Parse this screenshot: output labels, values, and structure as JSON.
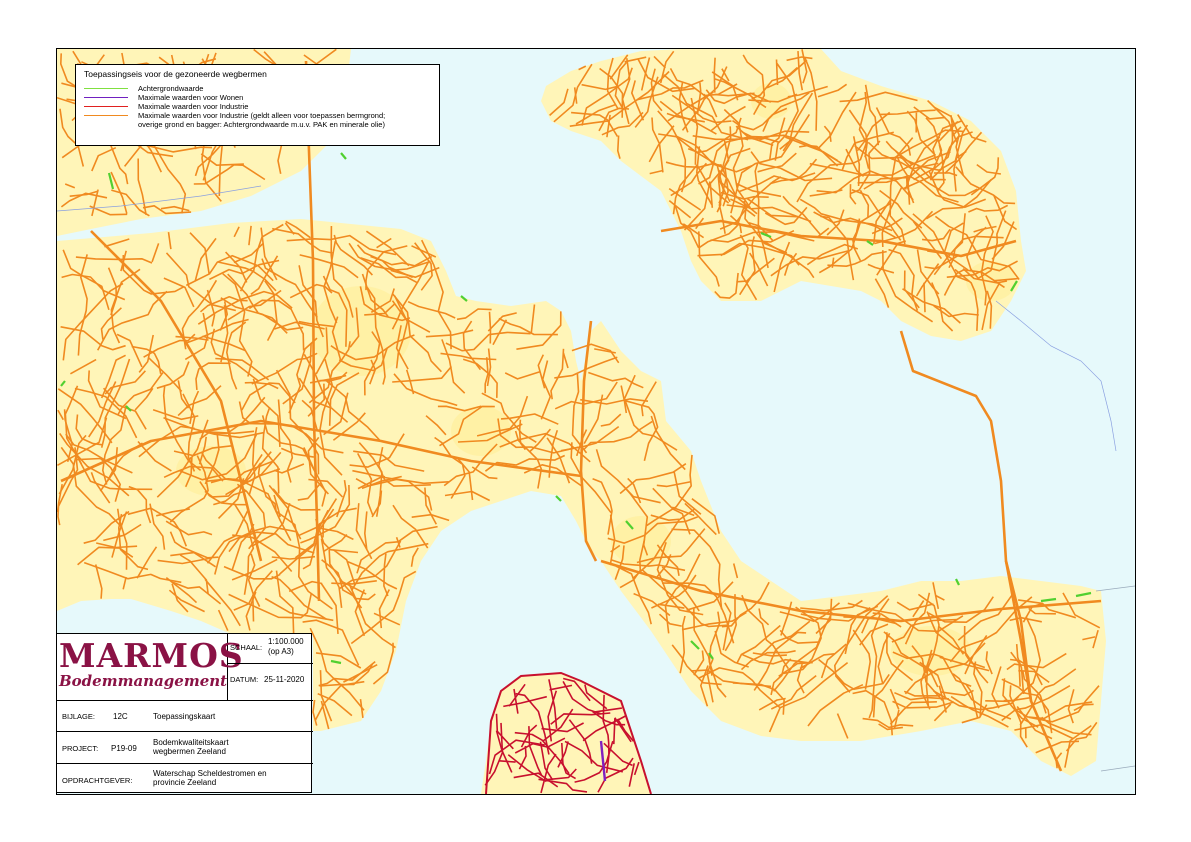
{
  "legend": {
    "title": "Toepassingseis voor de gezoneerde wegbermen",
    "items": [
      {
        "label": "Achtergrondwaarde",
        "color": "#80e040"
      },
      {
        "label": "Maximale waarden voor Wonen",
        "color": "#7020c0"
      },
      {
        "label": "Maximale waarden voor Industrie",
        "color": "#e02020"
      },
      {
        "label": "Maximale waarden voor Industrie (geldt alleen voor toepassen bermgrond;",
        "label2": "overige grond en bagger: Achtergrondwaarde m.u.v. PAK en minerale olie)",
        "color": "#f08a20"
      }
    ]
  },
  "colors": {
    "water": "#e6f9fb",
    "land": "#fff5b8",
    "road": "#f08a20",
    "road_red": "#c8102e",
    "road_green": "#50d030",
    "road_purple": "#8020c0",
    "logo": "#8a1245"
  },
  "titleblock": {
    "logo_main": "MARMOS",
    "logo_sub": "Bodemmanagement",
    "schaal_label": "SCHAAL:",
    "schaal_value": "1:100.000",
    "schaal_note": "(op A3)",
    "datum_label": "DATUM:",
    "datum_value": "25-11-2020",
    "bijlage_label": "BIJLAGE:",
    "bijlage_num": "12C",
    "bijlage_title": "Toepassingskaart",
    "project_label": "PROJECT:",
    "project_code": "P19-09",
    "project_title_1": "Bodemkwaliteitskaart",
    "project_title_2": "wegbermen Zeeland",
    "opdrachtgever_label": "OPDRACHTGEVER:",
    "opdrachtgever_1": "Waterschap Scheldestromen en",
    "opdrachtgever_2": "provincie Zeeland"
  }
}
